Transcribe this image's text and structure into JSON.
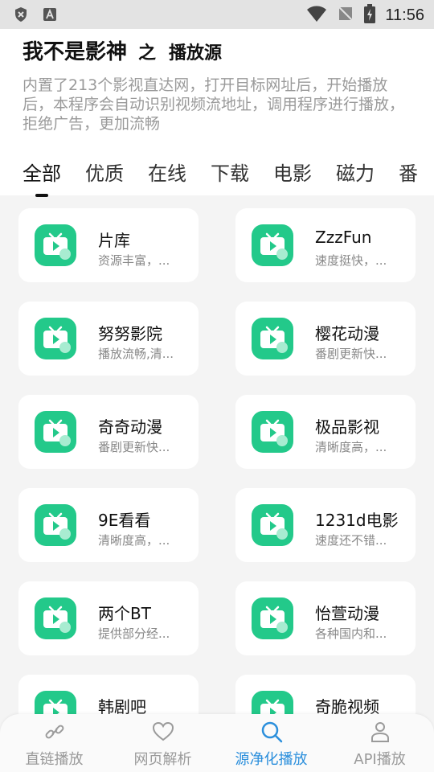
{
  "status_bar": {
    "time": "11:56"
  },
  "header": {
    "title": "我不是影神",
    "separator": "之",
    "subtitle": "播放源",
    "description": "内置了213个影视直达网，打开目标网址后，开始播放后，本程序会自动识别视频流地址，调用程序进行播放，拒绝广告，更加流畅"
  },
  "tabs": [
    {
      "label": "全部",
      "active": true
    },
    {
      "label": "优质"
    },
    {
      "label": "在线"
    },
    {
      "label": "下载"
    },
    {
      "label": "电影"
    },
    {
      "label": "磁力"
    },
    {
      "label": "番"
    }
  ],
  "sources": [
    {
      "name": "片库",
      "desc": "资源丰富，..."
    },
    {
      "name": "ZzzFun",
      "desc": "速度挺快，..."
    },
    {
      "name": "努努影院",
      "desc": "播放流畅,清..."
    },
    {
      "name": "樱花动漫",
      "desc": "番剧更新快..."
    },
    {
      "name": "奇奇动漫",
      "desc": "番剧更新快..."
    },
    {
      "name": "极品影视",
      "desc": "清晰度高，..."
    },
    {
      "name": "9E看看",
      "desc": "清晰度高，..."
    },
    {
      "name": "1231d电影",
      "desc": "速度还不错..."
    },
    {
      "name": "两个BT",
      "desc": "提供部分经..."
    },
    {
      "name": "怡萱动漫",
      "desc": "各种国内和..."
    },
    {
      "name": "韩剧吧",
      "desc": ""
    },
    {
      "name": "奇脆视频",
      "desc": ""
    }
  ],
  "bottom_nav": [
    {
      "label": "直链播放",
      "icon": "link-icon"
    },
    {
      "label": "网页解析",
      "icon": "heart-icon"
    },
    {
      "label": "源净化播放",
      "icon": "search-icon",
      "active": true
    },
    {
      "label": "API播放",
      "icon": "person-icon"
    }
  ],
  "colors": {
    "accent_green": "#23c98a",
    "active_blue": "#2b8fdc"
  }
}
